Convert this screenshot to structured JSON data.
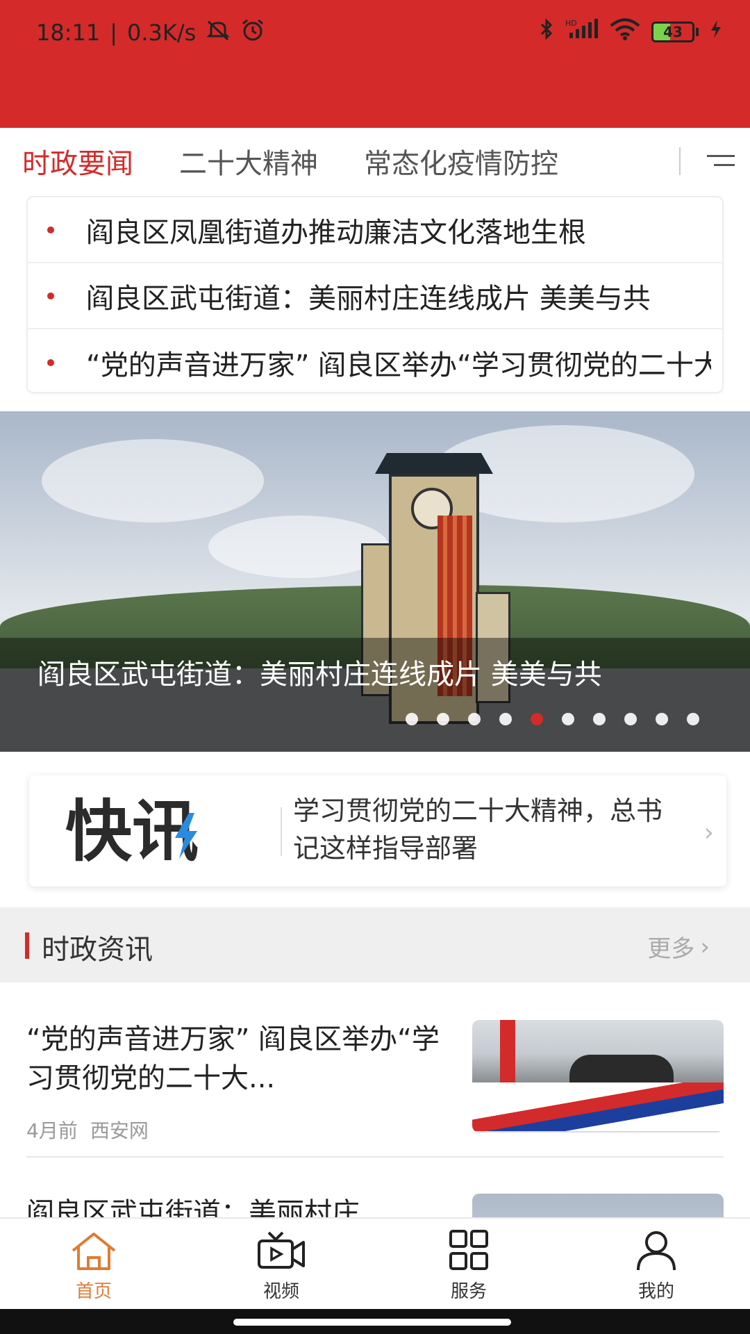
{
  "status_bar": {
    "time": "18:11",
    "speed": "0.3K/s",
    "battery": "43",
    "battery_level": 0.43,
    "network": "HD"
  },
  "tabs": [
    {
      "label": "时政要闻",
      "active": true
    },
    {
      "label": "二十大精神",
      "active": false
    },
    {
      "label": "常态化疫情防控",
      "active": false
    }
  ],
  "headlines": [
    "阎良区凤凰街道办推动廉洁文化落地生根",
    "阎良区武屯街道：美丽村庄连线成片  美美与共",
    "“党的声音进万家” 阎良区举办“学习贯彻党的二十大精神"
  ],
  "banner": {
    "caption": "阎良区武屯街道：美丽村庄连线成片  美美与共",
    "dots": 10,
    "active_dot": 5
  },
  "flash": {
    "logo_text": "快讯",
    "text": "学习贯彻党的二十大精神，总书记这样指导部署"
  },
  "section": {
    "title": "时政资讯",
    "more": "更多"
  },
  "news": [
    {
      "title": "“党的声音进万家” 阎良区举办“学习贯彻党的二十大...",
      "time": "4月前",
      "source": "西安网"
    },
    {
      "title": "阎良区武屯街道：美丽村庄"
    }
  ],
  "nav": [
    {
      "label": "首页",
      "icon": "home-icon",
      "active": true
    },
    {
      "label": "视频",
      "icon": "video-icon",
      "active": false
    },
    {
      "label": "服务",
      "icon": "grid-icon",
      "active": false
    },
    {
      "label": "我的",
      "icon": "person-icon",
      "active": false
    }
  ],
  "colors": {
    "brand_red": "#d42a2a",
    "active_nav": "#e07b33",
    "flash_bolt": "#2a8ce0"
  }
}
